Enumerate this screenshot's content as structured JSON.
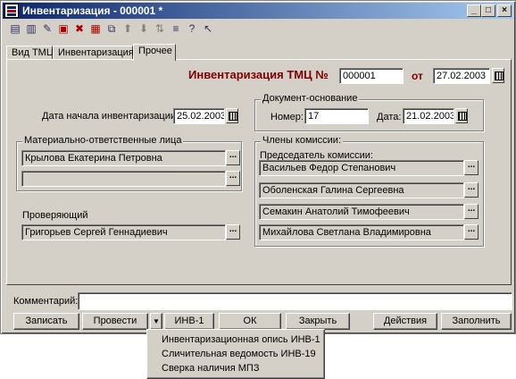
{
  "window": {
    "title": "Инвентаризация - 000001 *"
  },
  "title_buttons": [
    "_",
    "□",
    "×"
  ],
  "toolbar": {
    "icons": [
      "view-icon",
      "bill-icon",
      "edit-icon",
      "delete-icon",
      "dt-icon",
      "post-icon",
      "copy-icon",
      "up-arrow-icon",
      "down-arrow-icon",
      "sort-icon",
      "filter-icon",
      "help-icon",
      "whatsthis-icon"
    ]
  },
  "tabs": [
    "Вид ТМЦ",
    "Инвентаризация",
    "Прочее"
  ],
  "header": {
    "doc_title": "Инвентаризация ТМЦ №",
    "number": "000001",
    "from_label": "от",
    "date": "27.02.2003"
  },
  "start": {
    "label": "Дата начала инвентаризации",
    "date": "25.02.2003"
  },
  "basis": {
    "title": "Документ-основание",
    "number_label": "Номер:",
    "number": "17",
    "date_label": "Дата:",
    "date": "21.02.2003"
  },
  "responsible": {
    "title": "Материально-ответственные лица",
    "persons": [
      "Крылова Екатерина Петровна",
      ""
    ]
  },
  "commission": {
    "title": "Члены комиссии:",
    "chair_label": "Председатель комиссии:",
    "members": [
      "Васильев Федор Степанович",
      "Оболенская Галина Сергеевна",
      "Семакин Анатолий Тимофеевич",
      "Михайлова Светлана Владимировна"
    ]
  },
  "checker": {
    "label": "Проверяющий",
    "name": "Григорьев Сергей Геннадиевич"
  },
  "comment": {
    "label": "Комментарий:",
    "value": ""
  },
  "buttons": {
    "save": "Записать",
    "post": "Провести",
    "arrow": "▼",
    "inv1": "ИНВ-1",
    "ok": "ОК",
    "close": "Закрыть",
    "actions": "Действия",
    "fill": "Заполнить"
  },
  "dropdown": [
    "Инвентаризационная опись ИНВ-1",
    "Сличительная ведомость ИНВ-19",
    "Сверка наличия МПЗ"
  ],
  "colors": {
    "title_accent": "#800000",
    "titlebar_start": "#0a246a"
  }
}
